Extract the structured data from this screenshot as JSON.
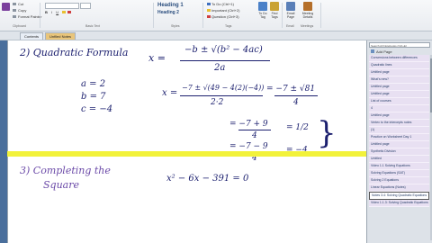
{
  "ribbon": {
    "left_items": [
      "Cut",
      "Copy",
      "Format Painter"
    ],
    "clipboard_label": "Clipboard",
    "basic_text_label": "Basic Text",
    "styles": [
      "Heading 1",
      "Heading 2"
    ],
    "styles_label": "Styles",
    "tags": [
      "To Do (Ctrl+1)",
      "Important (Ctrl+2)",
      "Question (Ctrl+3)"
    ],
    "tags_label": "Tags",
    "to_do_tag_label": "To Do Tag",
    "find_tags_label": "Find Tags",
    "email_page_label": "Email Page",
    "meeting_details_label": "Meeting Details",
    "email_group_label": "Email",
    "meetings_label": "Meetings"
  },
  "tabs": [
    "Contents",
    "Unfiled Notes"
  ],
  "notes": {
    "item2": "2) Quadratic Formula",
    "formula_x": "x =",
    "formula_num": "−b ± √(b² − 4ac)",
    "formula_den": "2a",
    "a_val": "a = 2",
    "b_val": "b = 7",
    "c_val": "c = −4",
    "sub_x": "x =",
    "sub_num": "−7 ± √(49 − 4(2)(−4))",
    "sub_den": "2·2",
    "sub_eq": "= −7 ± √81",
    "sub_eq_den": "4",
    "line2_num": "= −7 + 9",
    "line2_den": "4",
    "line2_res": "= 1/2",
    "line3_num": "= −7 − 9",
    "line3_den": "4",
    "line3_res": "= −4",
    "item3_a": "3) Completing the",
    "item3_b": "Square",
    "item3_eq": "x² − 6x − 391 = 0"
  },
  "panel": {
    "search_placeholder": "Search All Notebooks (Ctrl+E)",
    "add_page": "Add Page",
    "pages": [
      "Conversions between differences",
      "Quadratic lines",
      "Untitled page",
      "What's new?",
      "Untitled page",
      "Untitled page",
      "List of courses",
      "4",
      "Untitled page",
      "Vertex to the intercepts notes",
      "(1)",
      "Practice on Worksheet Day 1",
      "Untitled page",
      "Synthetic Division",
      "Untitled",
      "Video 1.1 Solving Equations",
      "Solving Equations (SAT)",
      "Solving 2 Equations",
      "Linear Equations (Notes)",
      "Notes 3.4: Solving Quadratic Equations",
      "Video 1.1.3: Solving Quadratic Equations"
    ]
  },
  "colors": {
    "ink": "#1b1f6e",
    "highlight": "#f2f23a",
    "accent": "#7a3f9d"
  }
}
